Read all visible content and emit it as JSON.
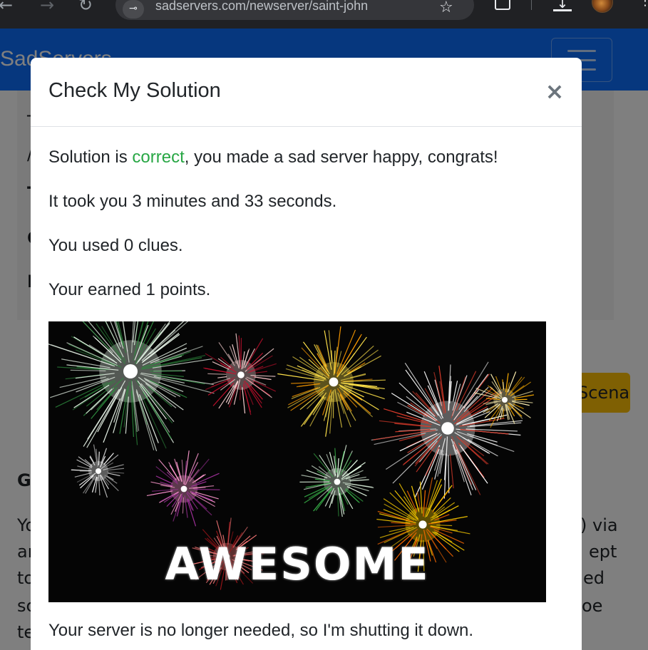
{
  "browser": {
    "url": "sadservers.com/newserver/saint-john",
    "back_glyph": "←",
    "forward_glyph": "→",
    "reload_glyph": "↻",
    "site_info_glyph": "⊸",
    "bookmark_glyph": "☆",
    "download_glyph": "↓",
    "menu_glyph": "⋮"
  },
  "navbar": {
    "brand": "SadServers",
    "color": "#0d6efd"
  },
  "background": {
    "card_fragments": [
      "T",
      "/",
      "T",
      "C",
      "F"
    ],
    "scenarios_button_label": "Scenarios",
    "section_heading": "G",
    "para_left": [
      "Yo",
      "ar",
      "to",
      "sc",
      "te"
    ],
    "para_right": [
      ") via",
      "ept",
      "ed",
      "oe"
    ]
  },
  "modal": {
    "title": "Check My Solution",
    "close_glyph": "×",
    "result_prefix": "Solution is ",
    "result_word": "correct",
    "result_suffix": ", you made a sad server happy, congrats!",
    "time_line": "It took you 3 minutes and 33 seconds.",
    "clues_line": "You used 0 clues.",
    "points_line": "Your earned 1 points.",
    "image_caption": "AWESOME",
    "shutdown_line": "Your server is no longer needed, so I'm shutting it down."
  },
  "colors": {
    "correct": "#28a745",
    "scenarios_button": "#ffc107",
    "backdrop": "rgba(0,0,0,0.5)"
  }
}
